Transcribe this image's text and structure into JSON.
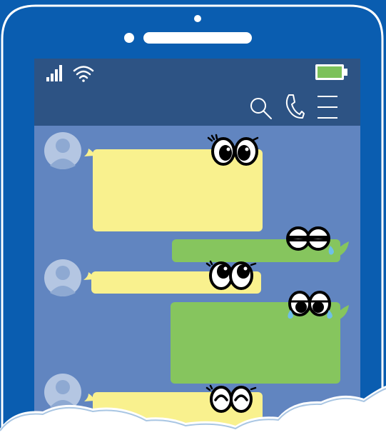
{
  "phone": {
    "body_color": "#0a5db0",
    "outline_color": "#ffffff",
    "screen_color": "#6185c0"
  },
  "status_bar": {
    "color": "#2d5384",
    "icons": [
      "signal-icon",
      "wifi-icon",
      "battery-icon"
    ],
    "battery_color": "#7cc15a"
  },
  "app_bar": {
    "icons": [
      "search-icon",
      "phone-call-icon",
      "menu-icon"
    ]
  },
  "chat": {
    "incoming_color": "#f9f18e",
    "outgoing_color": "#86c55e",
    "messages": [
      {
        "side": "incoming",
        "expression": "surprised-eyes"
      },
      {
        "side": "outgoing",
        "expression": "sleepy-eyes-with-tear"
      },
      {
        "side": "incoming",
        "expression": "looking-up-eyes"
      },
      {
        "side": "outgoing",
        "expression": "crying-eyes"
      },
      {
        "side": "incoming",
        "expression": "happy-eyes"
      }
    ]
  },
  "decoration": {
    "cloud_color": "#ffffff"
  }
}
